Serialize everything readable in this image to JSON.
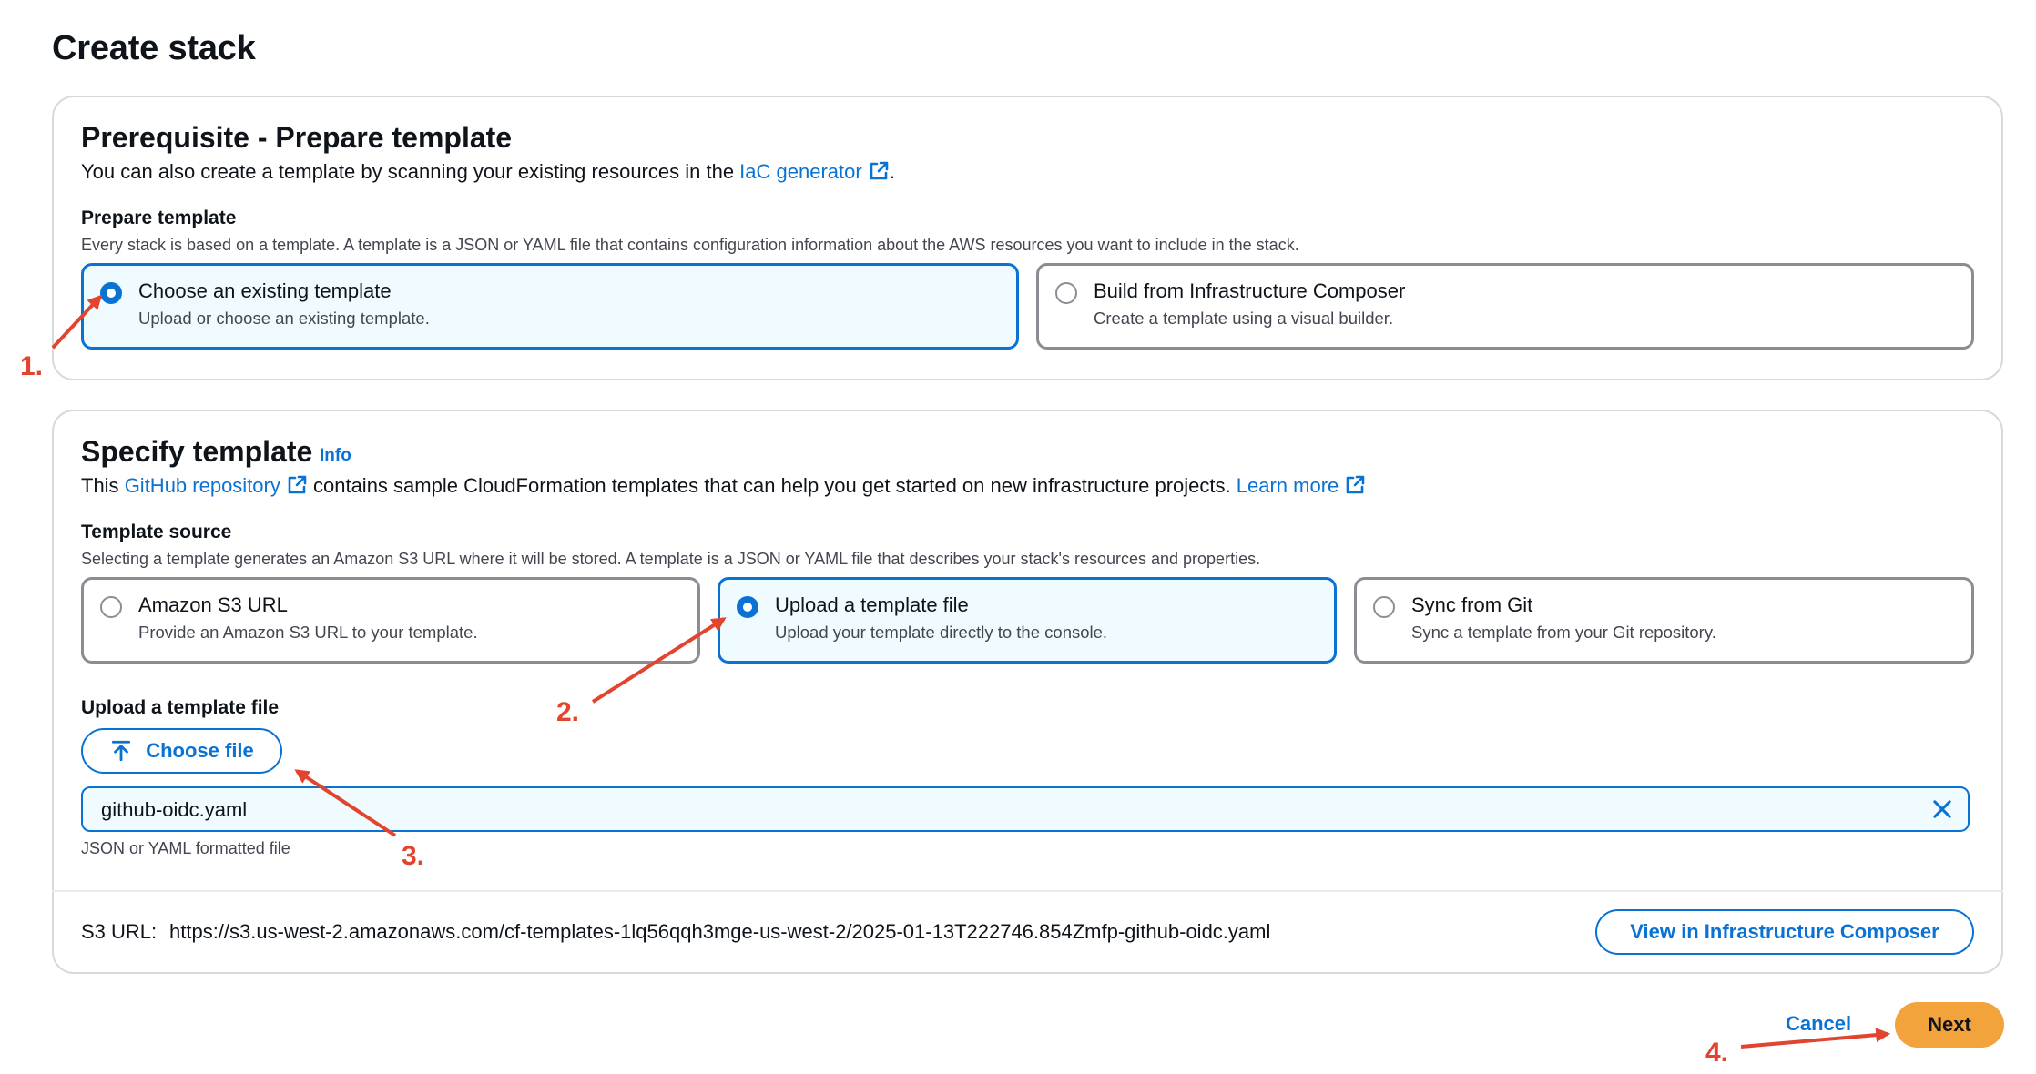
{
  "page": {
    "title": "Create stack"
  },
  "prerequisite": {
    "heading": "Prerequisite - Prepare template",
    "description_prefix": "You can also create a template by scanning your existing resources in the ",
    "description_link": "IaC generator",
    "description_suffix": ".",
    "field_label": "Prepare template",
    "field_hint": "Every stack is based on a template. A template is a JSON or YAML file that contains configuration information about the AWS resources you want to include in the stack.",
    "options": [
      {
        "title": "Choose an existing template",
        "subtitle": "Upload or choose an existing template.",
        "selected": true
      },
      {
        "title": "Build from Infrastructure Composer",
        "subtitle": "Create a template using a visual builder.",
        "selected": false
      }
    ]
  },
  "specify": {
    "heading": "Specify template",
    "info_link": "Info",
    "description_prefix": "This ",
    "github_link": "GitHub repository",
    "description_middle": " contains sample CloudFormation templates that can help you get started on new infrastructure projects. ",
    "learn_more_link": "Learn more",
    "source_label": "Template source",
    "source_hint": "Selecting a template generates an Amazon S3 URL where it will be stored. A template is a JSON or YAML file that describes your stack's resources and properties.",
    "sources": [
      {
        "title": "Amazon S3 URL",
        "subtitle": "Provide an Amazon S3 URL to your template.",
        "selected": false
      },
      {
        "title": "Upload a template file",
        "subtitle": "Upload your template directly to the console.",
        "selected": true
      },
      {
        "title": "Sync from Git",
        "subtitle": "Sync a template from your Git repository.",
        "selected": false
      }
    ],
    "upload_label": "Upload a template file",
    "choose_file_label": "Choose file",
    "file_name": "github-oidc.yaml",
    "file_hint": "JSON or YAML formatted file",
    "s3_url_label": "S3 URL:",
    "s3_url_value": "https://s3.us-west-2.amazonaws.com/cf-templates-1lq56qqh3mge-us-west-2/2025-01-13T222746.854Zmfp-github-oidc.yaml",
    "view_composer_label": "View in Infrastructure Composer"
  },
  "footer": {
    "cancel_label": "Cancel",
    "next_label": "Next"
  },
  "annotations": {
    "step1": "1.",
    "step2": "2.",
    "step3": "3.",
    "step4": "4."
  },
  "colors": {
    "accent": "#0972d3",
    "primary_button": "#f3a33b",
    "annotation": "#e2452f",
    "selected_tile_bg": "#f0fbff"
  },
  "icons": {
    "external": "external-link-icon",
    "upload": "upload-icon",
    "clear": "close-icon"
  }
}
